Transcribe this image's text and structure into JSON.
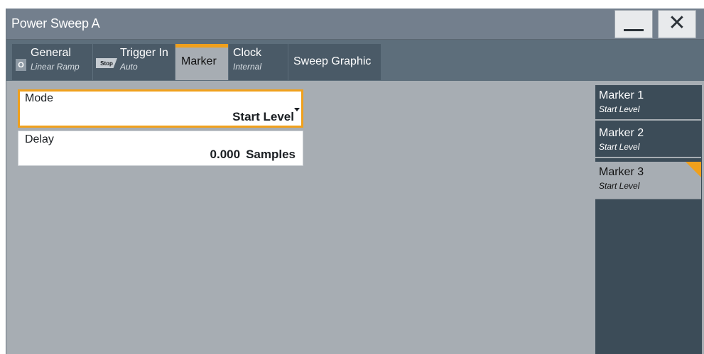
{
  "window": {
    "title": "Power Sweep A",
    "minimize_icon": "minimize-icon",
    "close_icon": "close-icon",
    "close_glyph": "✕"
  },
  "tabs": [
    {
      "label": "General",
      "sublabel": "Linear Ramp",
      "badge": "O"
    },
    {
      "label": "Trigger In",
      "sublabel": "Auto",
      "badge": "Stop"
    },
    {
      "label": "Marker",
      "selected": true
    },
    {
      "label": "Clock",
      "sublabel": "Internal"
    },
    {
      "label": "Sweep Graphic"
    }
  ],
  "fields": {
    "mode": {
      "label": "Mode",
      "value": "Start Level"
    },
    "delay": {
      "label": "Delay",
      "value": "0.000",
      "unit": "Samples"
    }
  },
  "markers": [
    {
      "label": "Marker 1",
      "sublabel": "Start Level"
    },
    {
      "label": "Marker 2",
      "sublabel": "Start Level"
    },
    {
      "label": "Marker 3",
      "sublabel": "Start Level",
      "selected": true
    }
  ],
  "colors": {
    "accent": "#f0a01c",
    "titlebar": "#737f8d",
    "tabbar": "#5d6e7b",
    "content_bg": "#a7adb3",
    "sidebar_bg": "#3c4c58"
  }
}
